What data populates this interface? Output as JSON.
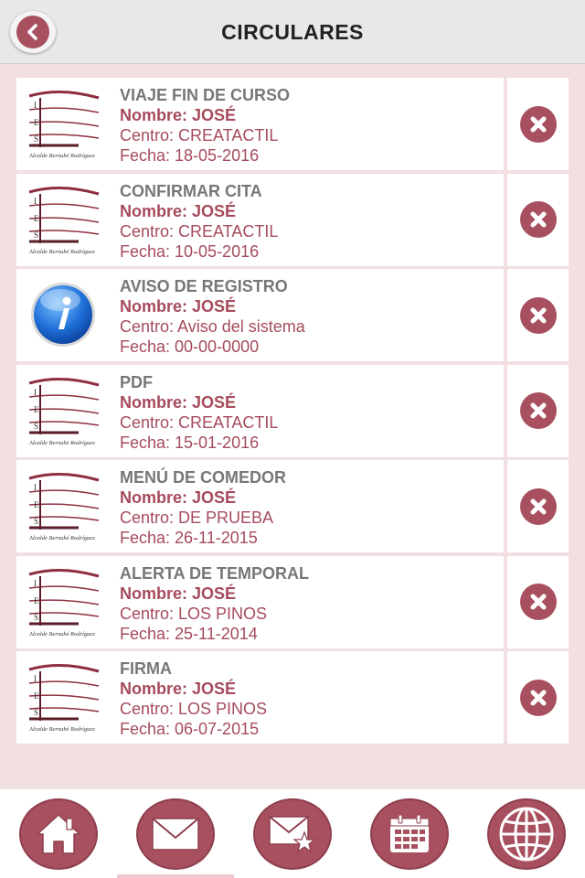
{
  "header": {
    "title": "CIRCULARES"
  },
  "items": [
    {
      "title": "VIAJE FIN DE CURSO",
      "nombre": "Nombre: JOSÉ",
      "centro": "Centro: CREATACTIL",
      "fecha": "Fecha: 18-05-2016",
      "icon": "school-logo-icon"
    },
    {
      "title": "CONFIRMAR CITA",
      "nombre": "Nombre: JOSÉ",
      "centro": "Centro: CREATACTIL",
      "fecha": "Fecha: 10-05-2016",
      "icon": "school-logo-icon"
    },
    {
      "title": "AVISO DE REGISTRO",
      "nombre": "Nombre: JOSÉ",
      "centro": "Centro: Aviso del sistema",
      "fecha": "Fecha: 00-00-0000",
      "icon": "info-icon"
    },
    {
      "title": "PDF",
      "nombre": "Nombre: JOSÉ",
      "centro": "Centro: CREATACTIL",
      "fecha": "Fecha: 15-01-2016",
      "icon": "school-logo-icon"
    },
    {
      "title": "MENÚ DE COMEDOR",
      "nombre": "Nombre: JOSÉ",
      "centro": "Centro: DE PRUEBA",
      "fecha": "Fecha: 26-11-2015",
      "icon": "school-logo-icon"
    },
    {
      "title": "ALERTA DE TEMPORAL",
      "nombre": "Nombre: JOSÉ",
      "centro": "Centro: LOS PINOS",
      "fecha": "Fecha: 25-11-2014",
      "icon": "school-logo-icon"
    },
    {
      "title": "FIRMA",
      "nombre": "Nombre: JOSÉ",
      "centro": "Centro: LOS PINOS",
      "fecha": "Fecha: 06-07-2015",
      "icon": "school-logo-icon"
    }
  ],
  "logo_caption": "Alcalde Bernabé Rodríguez",
  "nav": [
    "home-icon",
    "mail-icon",
    "mail-star-icon",
    "calendar-icon",
    "globe-icon"
  ],
  "colors": {
    "accent": "#a8505f",
    "background": "#f2dfe2",
    "title_gray": "#777777"
  }
}
